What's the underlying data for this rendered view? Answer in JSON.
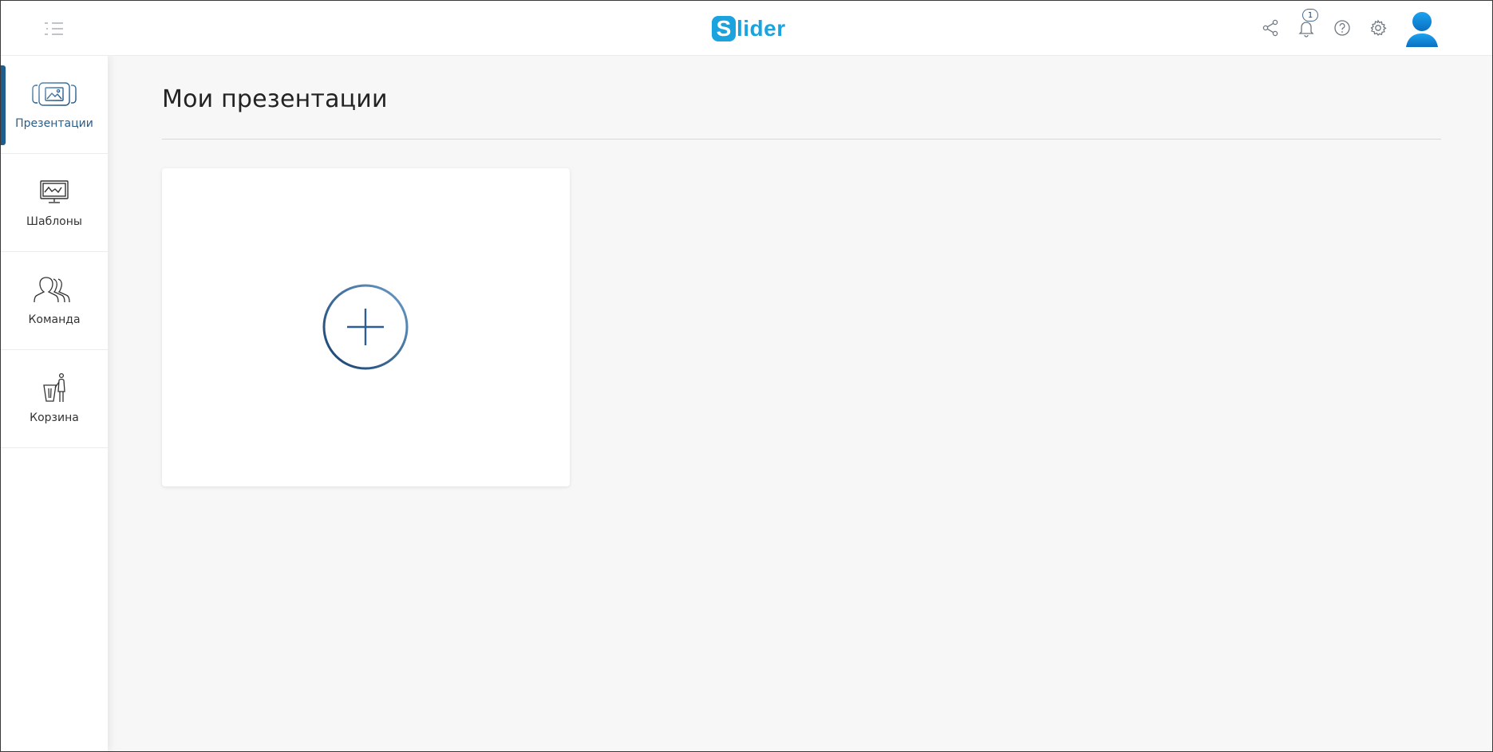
{
  "header": {
    "menu_icon": "menu-toggle-icon",
    "logo": {
      "mark": "S",
      "text": "lider",
      "color": "#1ba3df"
    },
    "icons": [
      "share-icon",
      "bell-icon",
      "help-icon",
      "gear-icon",
      "user-avatar-icon"
    ],
    "notification_count": "1"
  },
  "sidebar": {
    "items": [
      {
        "label": "Презентации",
        "icon": "presentations-icon",
        "active": true
      },
      {
        "label": "Шаблоны",
        "icon": "templates-monitor-icon",
        "active": false
      },
      {
        "label": "Команда",
        "icon": "team-icon",
        "active": false
      },
      {
        "label": "Корзина",
        "icon": "trash-icon",
        "active": false
      }
    ],
    "active_color": "#1d5e8e"
  },
  "main": {
    "title": "Мои презентации",
    "add_card_icon": "plus-circle-icon"
  }
}
